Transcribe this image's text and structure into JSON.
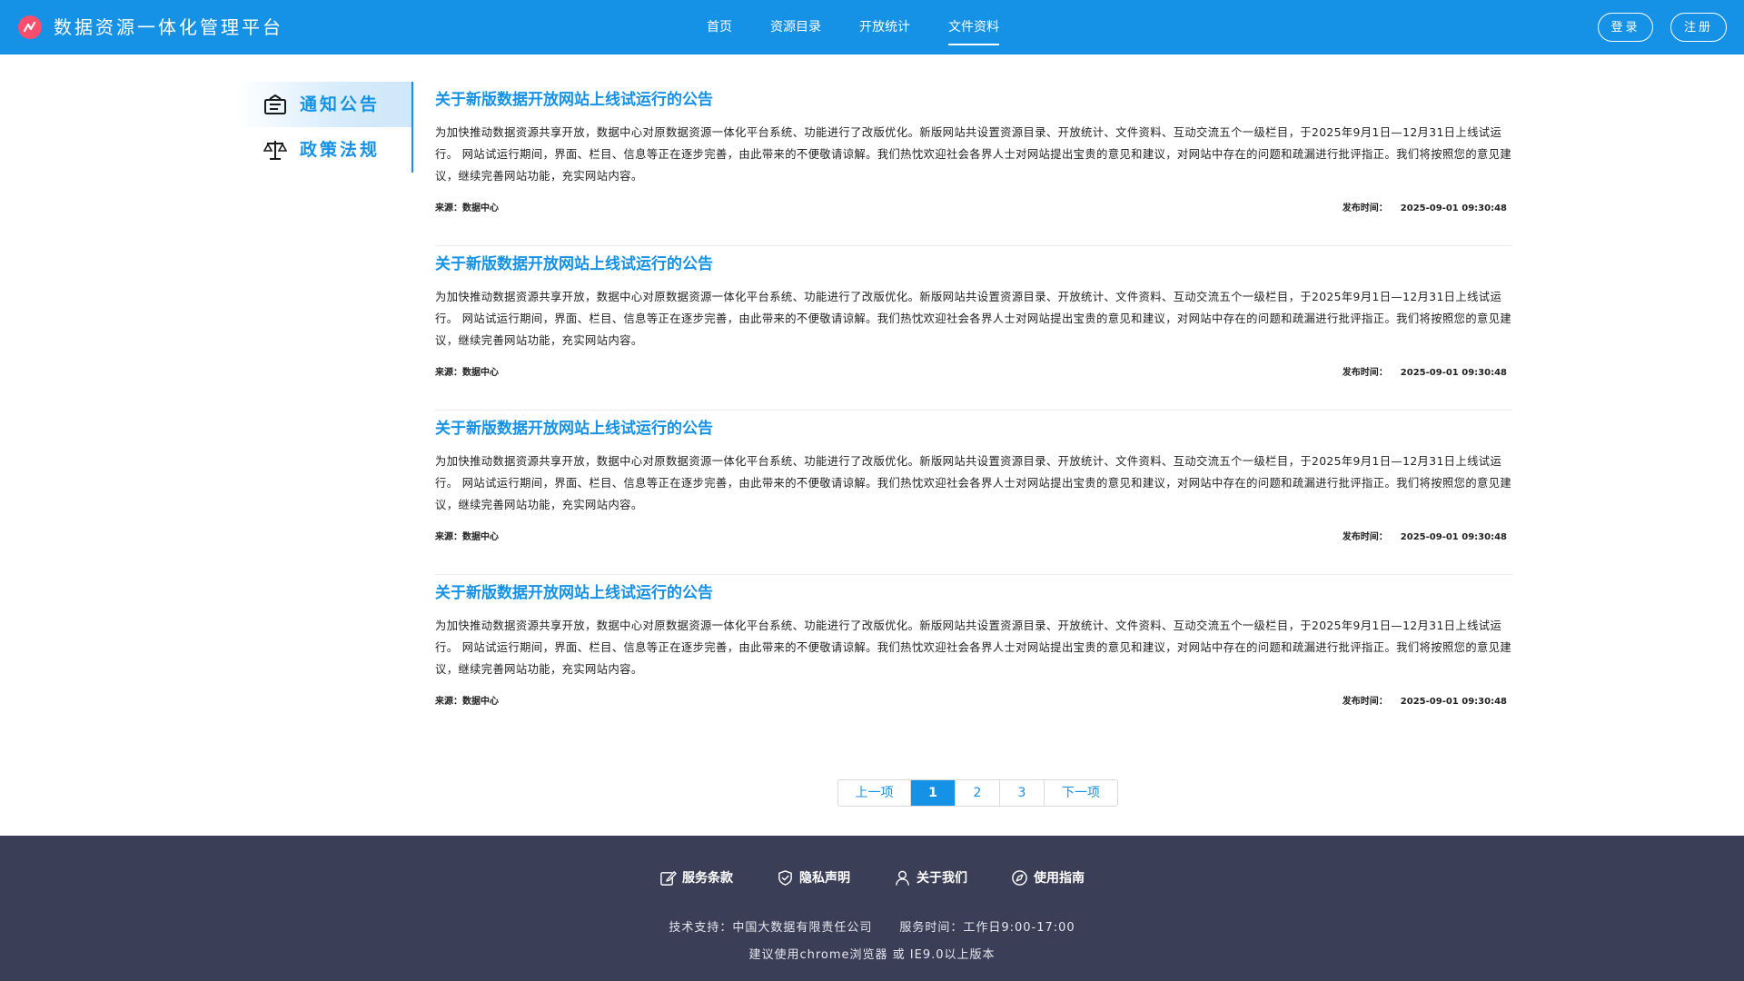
{
  "header": {
    "site_title": "数据资源一体化管理平台",
    "nav": [
      "首页",
      "资源目录",
      "开放统计",
      "文件资料"
    ],
    "active_nav": 3,
    "login_label": "登录",
    "register_label": "注册"
  },
  "sidebar": {
    "items": [
      {
        "label": "通知公告",
        "icon": "notice-icon"
      },
      {
        "label": "政策法规",
        "icon": "balance-scale-icon"
      }
    ]
  },
  "articles": [
    {
      "title": "关于新版数据开放网站上线试运行的公告",
      "body": "为加快推动数据资源共享开放，数据中心对原数据资源一体化平台系统、功能进行了改版优化。新版网站共设置资源目录、开放统计、文件资料、互动交流五个一级栏目，于2025年9月1日—12月31日上线试运行。 网站试运行期间，界面、栏目、信息等正在逐步完善，由此带来的不便敬请谅解。我们热忱欢迎社会各界人士对网站提出宝贵的意见和建议，对网站中存在的问题和疏漏进行批评指正。我们将按照您的意见建议，继续完善网站功能，充实网站内容。",
      "source": "来源：数据中心",
      "time_label": "发布时间：",
      "time": "2025-09-01 09:30:48"
    },
    {
      "title": "关于新版数据开放网站上线试运行的公告",
      "body": "为加快推动数据资源共享开放，数据中心对原数据资源一体化平台系统、功能进行了改版优化。新版网站共设置资源目录、开放统计、文件资料、互动交流五个一级栏目，于2025年9月1日—12月31日上线试运行。 网站试运行期间，界面、栏目、信息等正在逐步完善，由此带来的不便敬请谅解。我们热忱欢迎社会各界人士对网站提出宝贵的意见和建议，对网站中存在的问题和疏漏进行批评指正。我们将按照您的意见建议，继续完善网站功能，充实网站内容。",
      "source": "来源：数据中心",
      "time_label": "发布时间：",
      "time": "2025-09-01 09:30:48"
    },
    {
      "title": "关于新版数据开放网站上线试运行的公告",
      "body": "为加快推动数据资源共享开放，数据中心对原数据资源一体化平台系统、功能进行了改版优化。新版网站共设置资源目录、开放统计、文件资料、互动交流五个一级栏目，于2025年9月1日—12月31日上线试运行。 网站试运行期间，界面、栏目、信息等正在逐步完善，由此带来的不便敬请谅解。我们热忱欢迎社会各界人士对网站提出宝贵的意见和建议，对网站中存在的问题和疏漏进行批评指正。我们将按照您的意见建议，继续完善网站功能，充实网站内容。",
      "source": "来源：数据中心",
      "time_label": "发布时间：",
      "time": "2025-09-01 09:30:48"
    },
    {
      "title": "关于新版数据开放网站上线试运行的公告",
      "body": "为加快推动数据资源共享开放，数据中心对原数据资源一体化平台系统、功能进行了改版优化。新版网站共设置资源目录、开放统计、文件资料、互动交流五个一级栏目，于2025年9月1日—12月31日上线试运行。 网站试运行期间，界面、栏目、信息等正在逐步完善，由此带来的不便敬请谅解。我们热忱欢迎社会各界人士对网站提出宝贵的意见和建议，对网站中存在的问题和疏漏进行批评指正。我们将按照您的意见建议，继续完善网站功能，充实网站内容。",
      "source": "来源：数据中心",
      "time_label": "发布时间：",
      "time": "2025-09-01 09:30:48"
    }
  ],
  "pagination": {
    "prev_label": "上一项",
    "pages": [
      "1",
      "2",
      "3"
    ],
    "current_page": 1,
    "next_label": "下一项"
  },
  "footer": {
    "links": [
      {
        "label": "服务条款",
        "icon": "edit-icon"
      },
      {
        "label": "隐私声明",
        "icon": "shield-check-icon"
      },
      {
        "label": "关于我们",
        "icon": "user-icon"
      },
      {
        "label": "使用指南",
        "icon": "compass-icon"
      }
    ],
    "tech_support": "技术支持：中国大数据有限责任公司",
    "service_time": "服务时间：工作日9:00-17:00",
    "browser_note": "建议使用chrome浏览器 或 IE9.0以上版本"
  },
  "colors": {
    "primary": "#1592e6",
    "footer_bg": "#3b3e57",
    "logo": "#ff4d6d"
  }
}
